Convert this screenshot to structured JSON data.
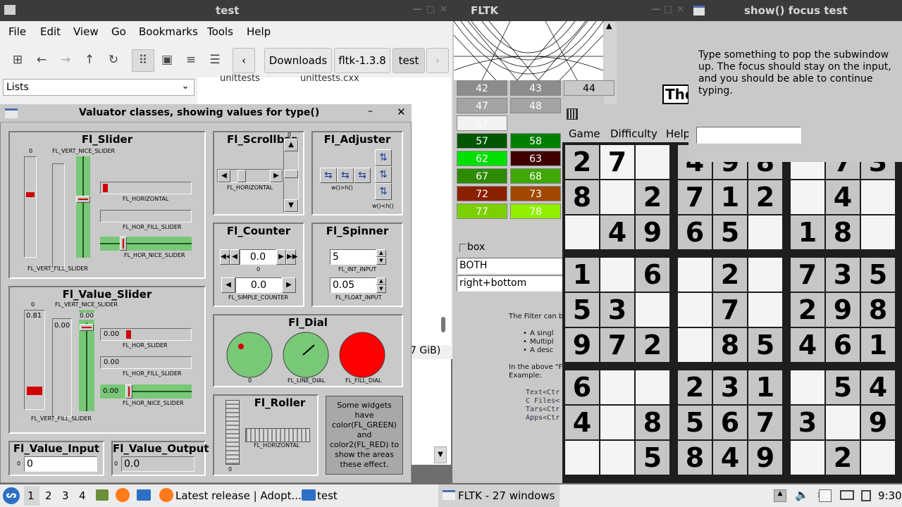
{
  "file_manager": {
    "title": "test",
    "menu": [
      "File",
      "Edit",
      "View",
      "Go",
      "Bookmarks",
      "Tools",
      "Help"
    ],
    "path": [
      "Downloads",
      "fltk-1.3.8",
      "test"
    ],
    "side_select": "Lists",
    "file_row": [
      "unittests",
      "unittests.cxx"
    ],
    "status_fragment": "7 GiB)"
  },
  "fltk_main": {
    "title": "FLTK",
    "grid": [
      [
        "42",
        "43",
        "44"
      ],
      [
        "47",
        "48",
        ""
      ],
      [
        "57",
        "",
        ""
      ],
      [
        "57",
        "58",
        ""
      ],
      [
        "62",
        "63",
        ""
      ],
      [
        "67",
        "68",
        ""
      ],
      [
        "72",
        "73",
        ""
      ],
      [
        "77",
        "78",
        ""
      ]
    ],
    "box_label": "box",
    "field1": "BOTH",
    "field2": "right+bottom",
    "doc": {
      "line1": "The Filter can b",
      "bullets": [
        "A singl",
        "Multipl",
        "A desc"
      ],
      "line2": "In the above \"F",
      "line3": "Example:",
      "code": [
        "Text<Ctr",
        "C Files<",
        "Tars<Ctr",
        "Apps<Ctr"
      ]
    },
    "heading_fragment": "The"
  },
  "focus_test": {
    "title": "show() focus test",
    "message": "Type something to pop the subwindow up. The focus should stay on the input, and you should be able to continue typing.",
    "input_value": ""
  },
  "sudoku": {
    "menu": [
      "Game",
      "Difficulty",
      "Help"
    ],
    "cells": [
      [
        "2",
        "7",
        "",
        "4",
        "9",
        "8",
        "",
        "7",
        "3"
      ],
      [
        "8",
        "",
        "2",
        "7",
        "1",
        "2",
        "",
        "4",
        ""
      ],
      [
        "",
        "4",
        "9",
        "6",
        "5",
        "",
        "1",
        "8",
        ""
      ],
      [
        "1",
        "",
        "6",
        "",
        "2",
        "",
        "7",
        "3",
        "5"
      ],
      [
        "5",
        "3",
        "",
        "",
        "7",
        "",
        "2",
        "9",
        "8"
      ],
      [
        "9",
        "7",
        "2",
        "",
        "8",
        "5",
        "4",
        "6",
        "1"
      ],
      [
        "6",
        "",
        "",
        "2",
        "3",
        "1",
        "",
        "5",
        "4"
      ],
      [
        "4",
        "",
        "8",
        "5",
        "6",
        "7",
        "3",
        "",
        "9"
      ],
      [
        "",
        "",
        "5",
        "8",
        "4",
        "9",
        "",
        "2",
        ""
      ]
    ],
    "given": [
      [
        1,
        0,
        0,
        1,
        1,
        1,
        0,
        1,
        1
      ],
      [
        1,
        0,
        1,
        1,
        1,
        1,
        0,
        1,
        0
      ],
      [
        0,
        1,
        1,
        1,
        1,
        0,
        1,
        1,
        0
      ],
      [
        1,
        0,
        1,
        0,
        1,
        0,
        1,
        1,
        1
      ],
      [
        1,
        1,
        0,
        0,
        1,
        0,
        1,
        1,
        1
      ],
      [
        1,
        1,
        1,
        0,
        1,
        1,
        1,
        1,
        1
      ],
      [
        1,
        0,
        0,
        1,
        1,
        1,
        0,
        1,
        1
      ],
      [
        1,
        0,
        1,
        1,
        1,
        1,
        1,
        0,
        1
      ],
      [
        0,
        0,
        1,
        1,
        1,
        1,
        0,
        1,
        0
      ]
    ]
  },
  "valuators": {
    "title": "Valuator classes, showing values for type()",
    "slider": {
      "label": "Fl_Slider",
      "vert_nice": "FL_VERT_NICE_SLIDER",
      "vert_fill": "FL_VERT_FILL_SLIDER",
      "horizontal": "FL_HORIZONTAL",
      "hor_fill": "FL_HOR_FILL_SLIDER",
      "hor_nice": "FL_HOR_NICE_SLIDER",
      "zero": "0"
    },
    "scrollbar": {
      "label": "Fl_Scrollbar",
      "horizontal": "FL_HORIZONTAL",
      "zero": "0"
    },
    "adjuster": {
      "label": "Fl_Adjuster",
      "wh": "w()>h()",
      "wlh": "w()<h()"
    },
    "counter": {
      "label": "Fl_Counter",
      "value1": "0.0",
      "value2": "0.0",
      "zero": "0",
      "simple": "FL_SIMPLE_COUNTER"
    },
    "spinner": {
      "label": "Fl_Spinner",
      "int_value": "5",
      "int_label": "FL_INT_INPUT",
      "float_value": "0.05",
      "float_label": "FL_FLOAT_INPUT"
    },
    "value_slider": {
      "label": "Fl_Value_Slider",
      "vert_nice": "FL_VERT_NICE_SLIDER",
      "vert_fill": "FL_VERT_FILL_SLIDER",
      "zero": "0",
      "v1": "0.81",
      "v2": "0.00",
      "v3": "0.00",
      "h1": "0.00",
      "h1_label": "FL_HOR_SLIDER",
      "h2": "0.00",
      "h2_label": "FL_HOR_FILL_SLIDER",
      "h3": "0.00",
      "h3_label": "FL_HOR_NICE_SLIDER"
    },
    "dial": {
      "label": "Fl_Dial",
      "zero": "0",
      "line": "FL_LINE_DIAL",
      "fill": "FL_FILL_DIAL"
    },
    "roller": {
      "label": "Fl_Roller",
      "horizontal": "FL_HORIZONTAL",
      "zero": "0"
    },
    "note": "Some widgets have color(FL_GREEN) and color2(FL_RED) to show the areas these effect.",
    "value_input": {
      "label": "Fl_Value_Input",
      "value": "0",
      "zero": "0"
    },
    "value_output": {
      "label": "Fl_Value_Output",
      "value": "0.0",
      "zero": "0"
    },
    "colors": {
      "green": "#78c878",
      "red": "#d00000"
    }
  },
  "taskbar": {
    "workspaces": [
      "1",
      "2",
      "3",
      "4"
    ],
    "task1": "Latest release | Adopt...",
    "task2": "test",
    "task3": "FLTK - 27 windows",
    "clock": "9:30"
  }
}
